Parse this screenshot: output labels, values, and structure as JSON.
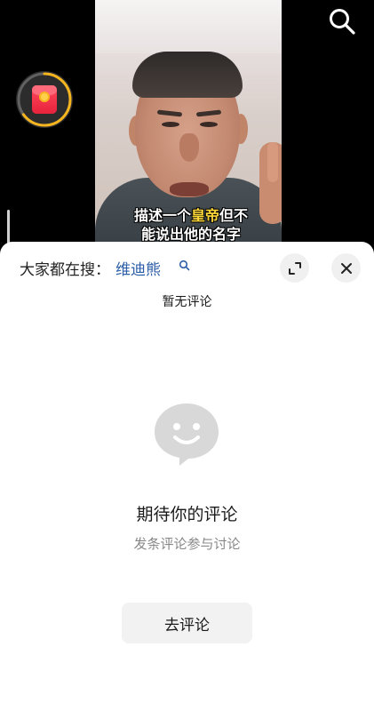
{
  "video": {
    "caption_line1_pre": "描述一个",
    "caption_line1_hl": "皇帝",
    "caption_line1_post": "但不",
    "caption_line2": "能说出他的名字"
  },
  "icons": {
    "search": "search-icon",
    "red_packet": "red-packet-icon",
    "expand": "expand-icon",
    "close": "close-icon",
    "empty_comment": "smiley-chat-bubble-icon"
  },
  "comments_sheet": {
    "search_prefix": "大家都在搜：",
    "search_term": "维迪熊",
    "no_comments_label": "暂无评论",
    "empty_title": "期待你的评论",
    "empty_subtitle": "发条评论参与讨论",
    "go_comment_label": "去评论"
  },
  "colors": {
    "search_term": "#2c5fa8",
    "caption_highlight": "#ffd83a",
    "red_packet": "#e8233c",
    "ring_progress": "#f6b51e"
  },
  "red_packet_progress": 0.65
}
